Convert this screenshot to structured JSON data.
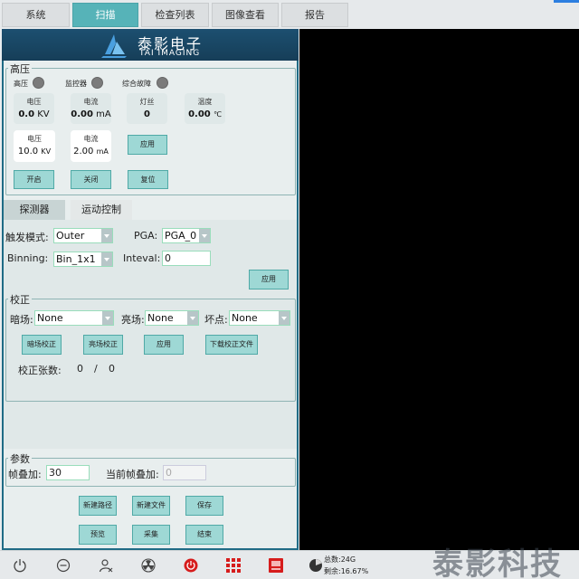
{
  "tabs": [
    "系统",
    "扫描",
    "检查列表",
    "图像查看",
    "报告"
  ],
  "active_tab": 1,
  "brand": {
    "cn": "泰影电子",
    "en": "TAI IMAGING"
  },
  "hv": {
    "title": "高压",
    "lamps": [
      "高压",
      "监控器",
      "综合故障"
    ],
    "read": {
      "voltage": {
        "cap": "电压",
        "value": "0.0",
        "unit": "KV"
      },
      "current": {
        "cap": "电流",
        "value": "0.00",
        "unit": "mA"
      },
      "filament": {
        "cap": "灯丝",
        "value": "0"
      },
      "temp": {
        "cap": "温度",
        "value": "0.00",
        "unit": "℃"
      }
    },
    "set": {
      "voltage": {
        "cap": "电压",
        "value": "10.0",
        "unit": "KV"
      },
      "current": {
        "cap": "电流",
        "value": "2.00",
        "unit": "mA"
      }
    },
    "apply": "应用",
    "on": "开启",
    "off": "关闭",
    "reset": "复位"
  },
  "subtabs": [
    "探测器",
    "运动控制"
  ],
  "detector": {
    "trigger_label": "触发模式:",
    "trigger_value": "Outer",
    "pga_label": "PGA:",
    "pga_value": "PGA_0",
    "binning_label": "Binning:",
    "binning_value": "Bin_1x1",
    "inteval_label": "Inteval:",
    "inteval_value": "0",
    "apply": "应用"
  },
  "calib": {
    "title": "校正",
    "dark_label": "暗场:",
    "dark_value": "None",
    "bright_label": "亮场:",
    "bright_value": "None",
    "bad_label": "坏点:",
    "bad_value": "None",
    "btn_dark": "暗场校正",
    "btn_bright": "亮场校正",
    "btn_apply": "应用",
    "btn_download": "下载校正文件",
    "count_label": "校正张数:",
    "count_a": "0",
    "sep": "/",
    "count_b": "0"
  },
  "params": {
    "title": "参数",
    "frame_label": "帧叠加:",
    "frame_value": "30",
    "current_label": "当前帧叠加:",
    "current_value": "0"
  },
  "actions": [
    "新建路径",
    "新建文件",
    "保存",
    "预览",
    "采集",
    "结束"
  ],
  "status": {
    "total": "总数:24G",
    "remain": "剩余:16.67%"
  },
  "watermark": "泰影科技"
}
